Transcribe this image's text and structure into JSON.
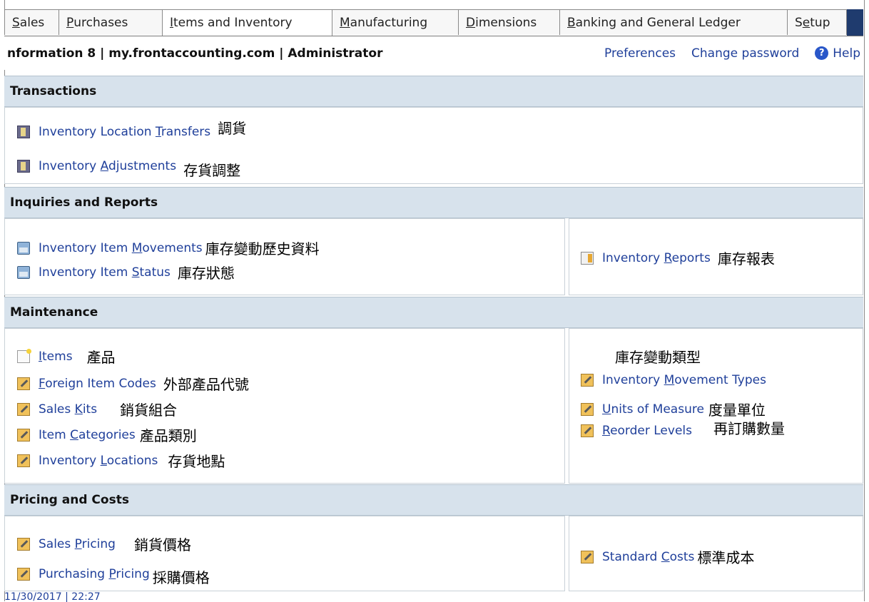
{
  "tabs": [
    {
      "pre": "",
      "key": "S",
      "post": "ales"
    },
    {
      "pre": "",
      "key": "P",
      "post": "urchases"
    },
    {
      "pre": "",
      "key": "I",
      "post": "tems and Inventory"
    },
    {
      "pre": "",
      "key": "M",
      "post": "anufacturing"
    },
    {
      "pre": "",
      "key": "D",
      "post": "imensions"
    },
    {
      "pre": "",
      "key": "B",
      "post": "anking and General Ledger"
    },
    {
      "pre": "S",
      "key": "e",
      "post": "tup"
    }
  ],
  "header": {
    "info": "nformation 8 | my.frontaccounting.com | Administrator",
    "preferences": "Preferences",
    "change_password": "Change password",
    "help": "Help",
    "help_icon": "?"
  },
  "sections": {
    "transactions": "Transactions",
    "inquiries": "Inquiries and Reports",
    "maintenance": "Maintenance",
    "pricing": "Pricing and Costs"
  },
  "transactions": [
    {
      "pre": "Inventory Location ",
      "key": "T",
      "post": "ransfers",
      "zh": "調貨"
    },
    {
      "pre": "Inventory ",
      "key": "A",
      "post": "djustments",
      "zh": "存貨調整"
    }
  ],
  "inquiries_left": [
    {
      "pre": "Inventory Item ",
      "key": "M",
      "post": "ovements",
      "zh": "庫存變動歷史資料"
    },
    {
      "pre": "Inventory Item ",
      "key": "S",
      "post": "tatus",
      "zh": "庫存狀態"
    }
  ],
  "inquiries_right": [
    {
      "pre": "Inventory ",
      "key": "R",
      "post": "eports",
      "zh": "庫存報表"
    }
  ],
  "maintenance_left": [
    {
      "pre": "",
      "key": "I",
      "post": "tems",
      "zh": "產品"
    },
    {
      "pre": "",
      "key": "F",
      "post": "oreign Item Codes",
      "zh": "外部產品代號"
    },
    {
      "pre": "Sales ",
      "key": "K",
      "post": "its",
      "zh": "銷貨組合"
    },
    {
      "pre": "Item ",
      "key": "C",
      "post": "ategories",
      "zh": "產品類別"
    },
    {
      "pre": "Inventory ",
      "key": "L",
      "post": "ocations",
      "zh": "存貨地點"
    }
  ],
  "maintenance_right_heading_zh": "庫存變動類型",
  "maintenance_right": [
    {
      "pre": "Inventory ",
      "key": "M",
      "post": "ovement Types",
      "zh": ""
    },
    {
      "pre": "",
      "key": "U",
      "post": "nits of Measure",
      "zh": "度量單位"
    },
    {
      "pre": "",
      "key": "R",
      "post": "eorder Levels",
      "zh": "再訂購數量"
    }
  ],
  "pricing_left": [
    {
      "pre": "Sales ",
      "key": "P",
      "post": "ricing",
      "zh": "銷貨價格"
    },
    {
      "pre": "Purchasing ",
      "key": "P",
      "post": "ricing",
      "zh": "採購價格"
    }
  ],
  "pricing_right": [
    {
      "pre": "Standard ",
      "key": "C",
      "post": "osts",
      "zh": "標準成本"
    }
  ],
  "footer_partial": "11/30/2017 | 22:27"
}
